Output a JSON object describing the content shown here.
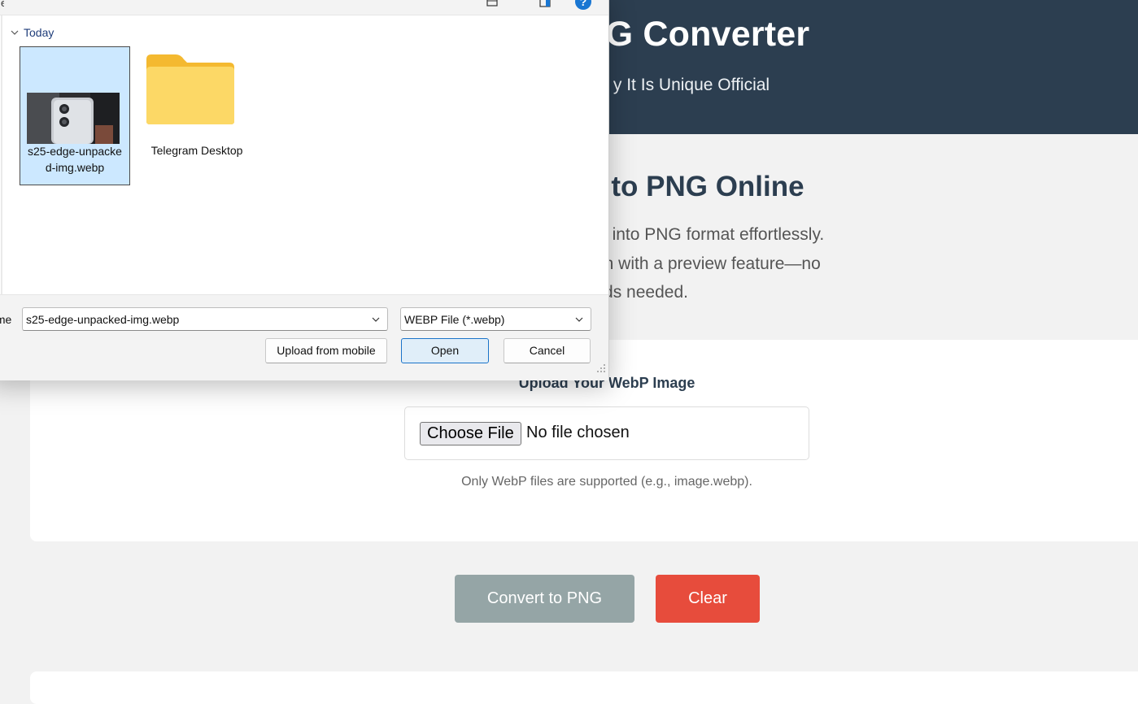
{
  "page": {
    "site_title": "G Converter",
    "site_tagline": "y It Is Unique Official",
    "hero_title": "to PNG Online",
    "hero_desc_lines": [
      "m your WebP images into PNG format effortlessly.",
      "st, reliable conversion with a preview feature—no",
      "loads needed."
    ],
    "upload_label": "Upload Your WebP Image",
    "choose_file_label": "Choose File",
    "no_file_text": "No file chosen",
    "file_hint": "Only WebP files are supported (e.g., image.webp).",
    "convert_label": "Convert to PNG",
    "clear_label": "Clear",
    "colors": {
      "header_bg": "#2c3e50",
      "convert_btn": "#95a5a6",
      "clear_btn": "#e74c3c"
    }
  },
  "dialog": {
    "title_fragment": "er",
    "help_glyph": "?",
    "group_label": "Today",
    "items": [
      {
        "name": "s25-edge-unpacked-img.webp",
        "type": "image",
        "selected": true
      },
      {
        "name": "Telegram Desktop",
        "type": "folder",
        "selected": false
      }
    ],
    "filename_label": "me:",
    "filename_value": "s25-edge-unpacked-img.webp",
    "filetype_value": "WEBP File (*.webp)",
    "upload_mobile_label": "Upload from mobile",
    "open_label": "Open",
    "cancel_label": "Cancel",
    "icons": [
      "chevron-down-icon",
      "view-options-icon",
      "preview-pane-icon",
      "help-icon",
      "folder-icon",
      "resize-grip-icon"
    ]
  }
}
